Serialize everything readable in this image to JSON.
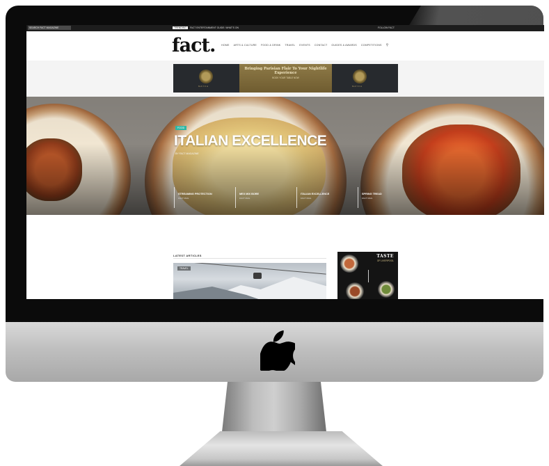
{
  "device": {
    "logo_icon": "apple-logo-icon"
  },
  "site": {
    "topbar": {
      "left_text": "SEARCH FACT MAGAZINE",
      "trending_tag": "TRENDING",
      "trending_text": "FACT ENTERTAINMENT GUIDE: WHAT'S ON",
      "right_text": "FOLLOW FACT"
    },
    "logo": "fact.",
    "nav": [
      "Home",
      "Arts & Culture",
      "Food & Drink",
      "Travel",
      "Events",
      "Contact",
      "Guides & Awards",
      "Competitions"
    ],
    "nav_search_icon": "search-icon",
    "ad": {
      "headline": "Bringing Parisian Flair To Your Nightlife Experience",
      "subline": "BOOK YOUR TABLE NOW",
      "emblem_label": "MAYFA"
    },
    "hero": {
      "tag": "FOOD",
      "title": "ITALIAN EXCELLENCE",
      "meta": "BY FACT MAGAZINE",
      "cards": [
        {
          "title": "Streaming Protection",
          "meta": "FACT MAG"
        },
        {
          "title": "Mex Mix Bore",
          "meta": "FACT MAG"
        },
        {
          "title": "Italian Excellence",
          "meta": "FACT MAG"
        },
        {
          "title": "Spring Tread",
          "meta": "FACT MAG"
        }
      ]
    },
    "latest": {
      "heading": "Latest Articles",
      "article_badge": "TRAVEL"
    },
    "side_ad": {
      "title": "TASTE",
      "subtitle": "OF LIVERPOOL"
    }
  }
}
